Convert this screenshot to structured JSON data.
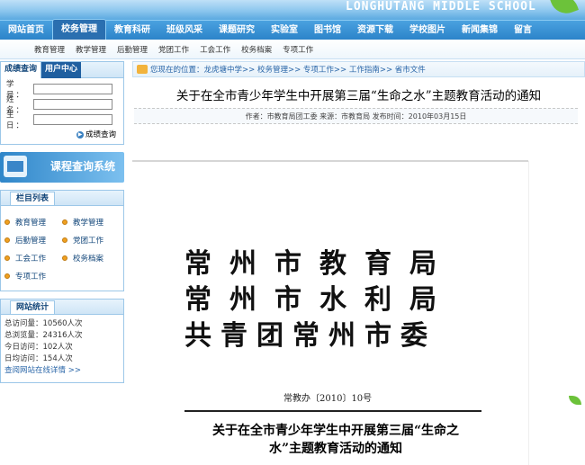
{
  "banner": {
    "school_name": "LONGHUTANG MIDDLE SCHOOL"
  },
  "main_nav": [
    "网站首页",
    "校务管理",
    "教育科研",
    "班级风采",
    "课题研究",
    "实验室",
    "图书馆",
    "资源下载",
    "学校图片",
    "新闻集锦",
    "留言"
  ],
  "main_nav_active": "校务管理",
  "sub_nav": [
    "教育管理",
    "教学管理",
    "后勤管理",
    "党团工作",
    "工会工作",
    "校务档案",
    "专项工作"
  ],
  "login": {
    "tab_active": "成绩查询",
    "tab_other": "用户中心",
    "fields": [
      "学 号：",
      "姓 名：",
      "生 日："
    ],
    "button": "成绩查询"
  },
  "course_banner": "课程查询系统",
  "column_list": {
    "title": "栏目列表",
    "items": [
      "教育管理",
      "教学管理",
      "后勤管理",
      "党团工作",
      "工会工作",
      "校务档案",
      "专项工作"
    ]
  },
  "stats": {
    "title": "网站统计",
    "lines": [
      "总访问量：10560人次",
      "总浏览量：24316人次",
      "今日访问：102人次",
      "日均访问：154人次"
    ],
    "more": "查阅网站在线详情 >>"
  },
  "breadcrumb": "您现在的位置：龙虎塘中学>> 校务管理>> 专项工作>> 工作指南>> 省市文件",
  "article": {
    "title": "关于在全市青少年学生中开展第三届“生命之水”主题教育活动的通知",
    "meta": "作者：市教育局团工委  来源：市教育局  发布时间：2010年03月15日"
  },
  "document": {
    "orgs": [
      "常州市教育局",
      "常州市水利局",
      "共青团常州市委"
    ],
    "doc_number": "常教办〔2010〕10号",
    "title_line1": "关于在全市青少年学生中开展第三届“生命之",
    "title_line2": "水”主题教育活动的通知"
  },
  "colors": {
    "nav_blue": "#2c84c9",
    "border_blue": "#9cc7e8",
    "accent_orange": "#f0a020"
  }
}
